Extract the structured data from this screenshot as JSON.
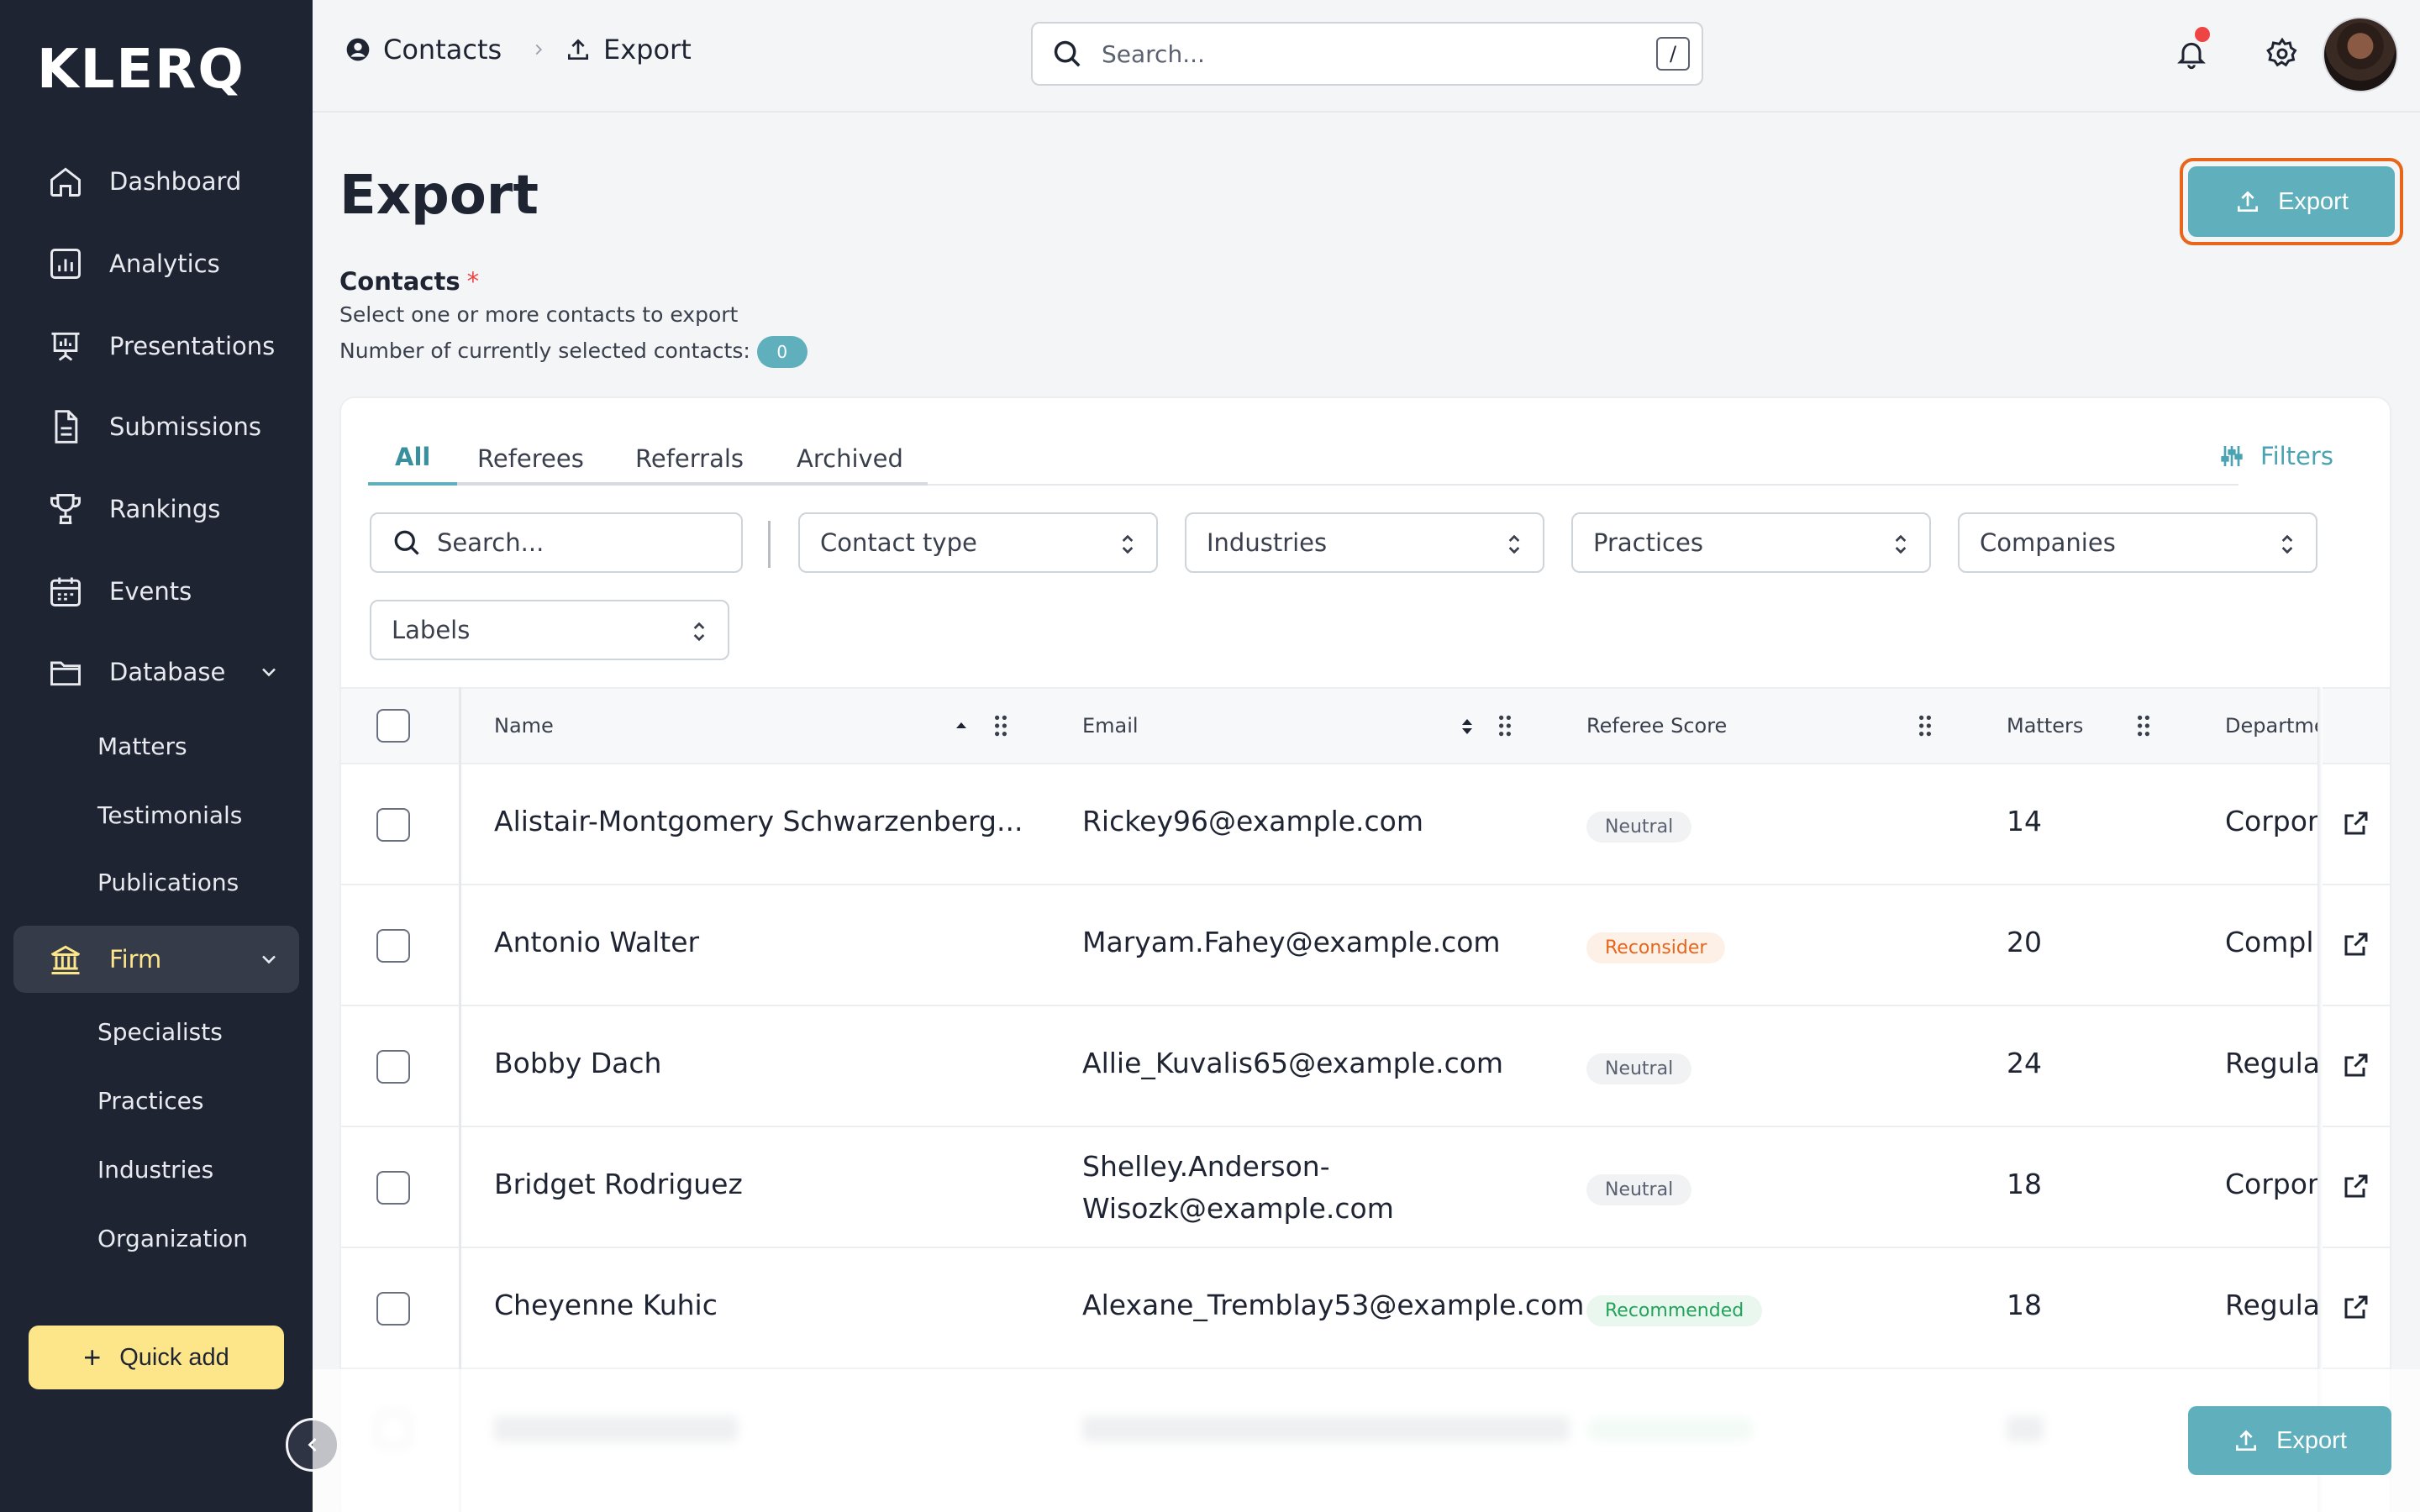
{
  "app": {
    "logo": "KLERQ"
  },
  "sidebar": {
    "items": [
      {
        "label": "Dashboard",
        "icon": "home-icon"
      },
      {
        "label": "Analytics",
        "icon": "analytics-icon"
      },
      {
        "label": "Presentations",
        "icon": "presentation-icon"
      },
      {
        "label": "Submissions",
        "icon": "document-icon"
      },
      {
        "label": "Rankings",
        "icon": "trophy-icon"
      },
      {
        "label": "Events",
        "icon": "calendar-icon"
      },
      {
        "label": "Database",
        "icon": "folder-icon"
      },
      {
        "label": "Firm",
        "icon": "bank-icon"
      }
    ],
    "database_sub": [
      "Matters",
      "Testimonials",
      "Publications"
    ],
    "firm_sub": [
      "Specialists",
      "Practices",
      "Industries",
      "Organization"
    ],
    "quick_add": "Quick add"
  },
  "topbar": {
    "breadcrumb": [
      "Contacts",
      "Export"
    ],
    "search_placeholder": "Search...",
    "search_shortcut": "/"
  },
  "page": {
    "title": "Export",
    "export_label": "Export",
    "contacts_label": "Contacts",
    "required_mark": "*",
    "help_line1": "Select one or more contacts to export",
    "help_line2": "Number of currently selected contacts:",
    "selected_count": "0"
  },
  "tabs": [
    "All",
    "Referees",
    "Referrals",
    "Archived"
  ],
  "filters_label": "Filters",
  "controls": {
    "search_placeholder": "Search...",
    "contact_type": "Contact type",
    "industries": "Industries",
    "practices": "Practices",
    "companies": "Companies",
    "labels": "Labels"
  },
  "table": {
    "columns": [
      "Name",
      "Email",
      "Referee Score",
      "Matters",
      "Departme"
    ],
    "rows": [
      {
        "name": "Alistair-Montgomery Schwarzenberg...",
        "email": "Rickey96@example.com",
        "score": "Neutral",
        "matters": "14",
        "dept": "Corpor"
      },
      {
        "name": "Antonio Walter",
        "email": "Maryam.Fahey@example.com",
        "score": "Reconsider",
        "matters": "20",
        "dept": "Compl"
      },
      {
        "name": "Bobby Dach",
        "email": "Allie_Kuvalis65@example.com",
        "score": "Neutral",
        "matters": "24",
        "dept": "Regula"
      },
      {
        "name": "Bridget Rodriguez",
        "email": "Shelley.Anderson-Wisozk@example.com",
        "score": "Neutral",
        "matters": "18",
        "dept": "Corpor"
      },
      {
        "name": "Cheyenne Kuhic",
        "email": "Alexane_Tremblay53@example.com",
        "score": "Recommended",
        "matters": "18",
        "dept": "Regula"
      }
    ]
  },
  "colors": {
    "sidebar": "#1f2433",
    "accent": "#5fafbc",
    "highlight": "#e8651a",
    "quick_add": "#fde68a"
  }
}
